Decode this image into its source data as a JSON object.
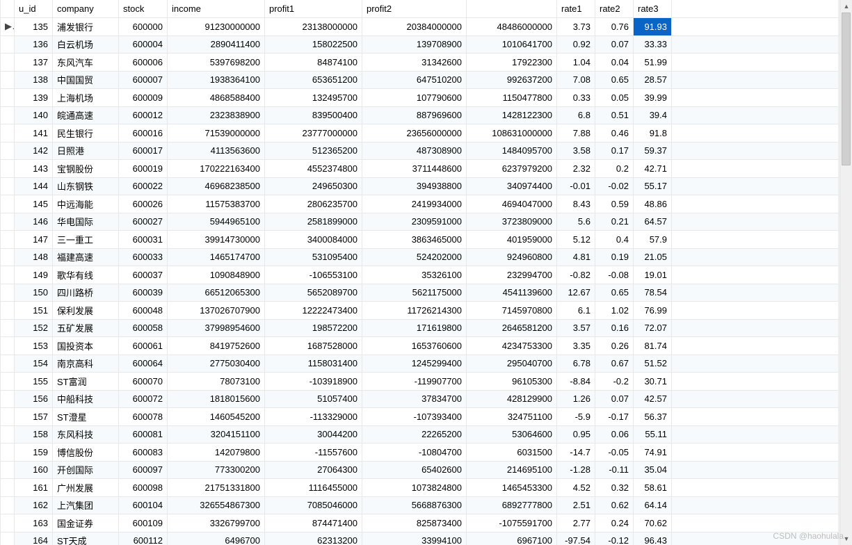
{
  "watermark": "CSDN @haohulala",
  "columns": {
    "u_id": "u_id",
    "company": "company",
    "stock": "stock",
    "income": "income",
    "profit1": "profit1",
    "profit2": "profit2",
    "blank": "",
    "rate1": "rate1",
    "rate2": "rate2",
    "rate3": "rate3"
  },
  "current_row_marker": "▶",
  "selected_cell": {
    "row": 0,
    "col": "rate3"
  },
  "rows": [
    {
      "u_id": "135",
      "company": "浦发银行",
      "stock": "600000",
      "income": "91230000000",
      "profit1": "23138000000",
      "profit2": "20384000000",
      "blank": "48486000000",
      "rate1": "3.73",
      "rate2": "0.76",
      "rate3": "91.93"
    },
    {
      "u_id": "136",
      "company": "白云机场",
      "stock": "600004",
      "income": "2890411400",
      "profit1": "158022500",
      "profit2": "139708900",
      "blank": "1010641700",
      "rate1": "0.92",
      "rate2": "0.07",
      "rate3": "33.33"
    },
    {
      "u_id": "137",
      "company": "东风汽车",
      "stock": "600006",
      "income": "5397698200",
      "profit1": "84874100",
      "profit2": "31342600",
      "blank": "17922300",
      "rate1": "1.04",
      "rate2": "0.04",
      "rate3": "51.99"
    },
    {
      "u_id": "138",
      "company": "中国国贸",
      "stock": "600007",
      "income": "1938364100",
      "profit1": "653651200",
      "profit2": "647510200",
      "blank": "992637200",
      "rate1": "7.08",
      "rate2": "0.65",
      "rate3": "28.57"
    },
    {
      "u_id": "139",
      "company": "上海机场",
      "stock": "600009",
      "income": "4868588400",
      "profit1": "132495700",
      "profit2": "107790600",
      "blank": "1150477800",
      "rate1": "0.33",
      "rate2": "0.05",
      "rate3": "39.99"
    },
    {
      "u_id": "140",
      "company": "皖通高速",
      "stock": "600012",
      "income": "2323838900",
      "profit1": "839500400",
      "profit2": "887969600",
      "blank": "1428122300",
      "rate1": "6.8",
      "rate2": "0.51",
      "rate3": "39.4"
    },
    {
      "u_id": "141",
      "company": "民生银行",
      "stock": "600016",
      "income": "71539000000",
      "profit1": "23777000000",
      "profit2": "23656000000",
      "blank": "108631000000",
      "rate1": "7.88",
      "rate2": "0.46",
      "rate3": "91.8"
    },
    {
      "u_id": "142",
      "company": "日照港",
      "stock": "600017",
      "income": "4113563600",
      "profit1": "512365200",
      "profit2": "487308900",
      "blank": "1484095700",
      "rate1": "3.58",
      "rate2": "0.17",
      "rate3": "59.37"
    },
    {
      "u_id": "143",
      "company": "宝钢股份",
      "stock": "600019",
      "income": "170222163400",
      "profit1": "4552374800",
      "profit2": "3711448600",
      "blank": "6237979200",
      "rate1": "2.32",
      "rate2": "0.2",
      "rate3": "42.71"
    },
    {
      "u_id": "144",
      "company": "山东钢铁",
      "stock": "600022",
      "income": "46968238500",
      "profit1": "249650300",
      "profit2": "394938800",
      "blank": "340974400",
      "rate1": "-0.01",
      "rate2": "-0.02",
      "rate3": "55.17"
    },
    {
      "u_id": "145",
      "company": "中远海能",
      "stock": "600026",
      "income": "11575383700",
      "profit1": "2806235700",
      "profit2": "2419934000",
      "blank": "4694047000",
      "rate1": "8.43",
      "rate2": "0.59",
      "rate3": "48.86"
    },
    {
      "u_id": "146",
      "company": "华电国际",
      "stock": "600027",
      "income": "5944965100",
      "profit1": "2581899000",
      "profit2": "2309591000",
      "blank": "3723809000",
      "rate1": "5.6",
      "rate2": "0.21",
      "rate3": "64.57"
    },
    {
      "u_id": "147",
      "company": "三一重工",
      "stock": "600031",
      "income": "39914730000",
      "profit1": "3400084000",
      "profit2": "3863465000",
      "blank": "401959000",
      "rate1": "5.12",
      "rate2": "0.4",
      "rate3": "57.9"
    },
    {
      "u_id": "148",
      "company": "福建高速",
      "stock": "600033",
      "income": "1465174700",
      "profit1": "531095400",
      "profit2": "524202000",
      "blank": "924960800",
      "rate1": "4.81",
      "rate2": "0.19",
      "rate3": "21.05"
    },
    {
      "u_id": "149",
      "company": "歌华有线",
      "stock": "600037",
      "income": "1090848900",
      "profit1": "-106553100",
      "profit2": "35326100",
      "blank": "232994700",
      "rate1": "-0.82",
      "rate2": "-0.08",
      "rate3": "19.01"
    },
    {
      "u_id": "150",
      "company": "四川路桥",
      "stock": "600039",
      "income": "66512065300",
      "profit1": "5652089700",
      "profit2": "5621175000",
      "blank": "4541139600",
      "rate1": "12.67",
      "rate2": "0.65",
      "rate3": "78.54"
    },
    {
      "u_id": "151",
      "company": "保利发展",
      "stock": "600048",
      "income": "137026707900",
      "profit1": "12222473400",
      "profit2": "11726214300",
      "blank": "7145970800",
      "rate1": "6.1",
      "rate2": "1.02",
      "rate3": "76.99"
    },
    {
      "u_id": "152",
      "company": "五矿发展",
      "stock": "600058",
      "income": "37998954600",
      "profit1": "198572200",
      "profit2": "171619800",
      "blank": "2646581200",
      "rate1": "3.57",
      "rate2": "0.16",
      "rate3": "72.07"
    },
    {
      "u_id": "153",
      "company": "国投资本",
      "stock": "600061",
      "income": "8419752600",
      "profit1": "1687528000",
      "profit2": "1653760600",
      "blank": "4234753300",
      "rate1": "3.35",
      "rate2": "0.26",
      "rate3": "81.74"
    },
    {
      "u_id": "154",
      "company": "南京高科",
      "stock": "600064",
      "income": "2775030400",
      "profit1": "1158031400",
      "profit2": "1245299400",
      "blank": "295040700",
      "rate1": "6.78",
      "rate2": "0.67",
      "rate3": "51.52"
    },
    {
      "u_id": "155",
      "company": "ST富润",
      "stock": "600070",
      "income": "78073100",
      "profit1": "-103918900",
      "profit2": "-119907700",
      "blank": "96105300",
      "rate1": "-8.84",
      "rate2": "-0.2",
      "rate3": "30.71"
    },
    {
      "u_id": "156",
      "company": "中船科技",
      "stock": "600072",
      "income": "1818015600",
      "profit1": "51057400",
      "profit2": "37834700",
      "blank": "428129900",
      "rate1": "1.26",
      "rate2": "0.07",
      "rate3": "42.57"
    },
    {
      "u_id": "157",
      "company": "ST澄星",
      "stock": "600078",
      "income": "1460545200",
      "profit1": "-113329000",
      "profit2": "-107393400",
      "blank": "324751100",
      "rate1": "-5.9",
      "rate2": "-0.17",
      "rate3": "56.37"
    },
    {
      "u_id": "158",
      "company": "东风科技",
      "stock": "600081",
      "income": "3204151100",
      "profit1": "30044200",
      "profit2": "22265200",
      "blank": "53064600",
      "rate1": "0.95",
      "rate2": "0.06",
      "rate3": "55.11"
    },
    {
      "u_id": "159",
      "company": "博信股份",
      "stock": "600083",
      "income": "142079800",
      "profit1": "-11557600",
      "profit2": "-10804700",
      "blank": "6031500",
      "rate1": "-14.7",
      "rate2": "-0.05",
      "rate3": "74.91"
    },
    {
      "u_id": "160",
      "company": "开创国际",
      "stock": "600097",
      "income": "773300200",
      "profit1": "27064300",
      "profit2": "65402600",
      "blank": "214695100",
      "rate1": "-1.28",
      "rate2": "-0.11",
      "rate3": "35.04"
    },
    {
      "u_id": "161",
      "company": "广州发展",
      "stock": "600098",
      "income": "21751331800",
      "profit1": "1116455000",
      "profit2": "1073824800",
      "blank": "1465453300",
      "rate1": "4.52",
      "rate2": "0.32",
      "rate3": "58.61"
    },
    {
      "u_id": "162",
      "company": "上汽集团",
      "stock": "600104",
      "income": "326554867300",
      "profit1": "7085046000",
      "profit2": "5668876300",
      "blank": "6892777800",
      "rate1": "2.51",
      "rate2": "0.62",
      "rate3": "64.14"
    },
    {
      "u_id": "163",
      "company": "国金证券",
      "stock": "600109",
      "income": "3326799700",
      "profit1": "874471400",
      "profit2": "825873400",
      "blank": "-1075591700",
      "rate1": "2.77",
      "rate2": "0.24",
      "rate3": "70.62"
    },
    {
      "u_id": "164",
      "company": "ST天成",
      "stock": "600112",
      "income": "6496700",
      "profit1": "62313200",
      "profit2": "33994100",
      "blank": "6967100",
      "rate1": "-97.54",
      "rate2": "-0.12",
      "rate3": "96.43"
    }
  ]
}
